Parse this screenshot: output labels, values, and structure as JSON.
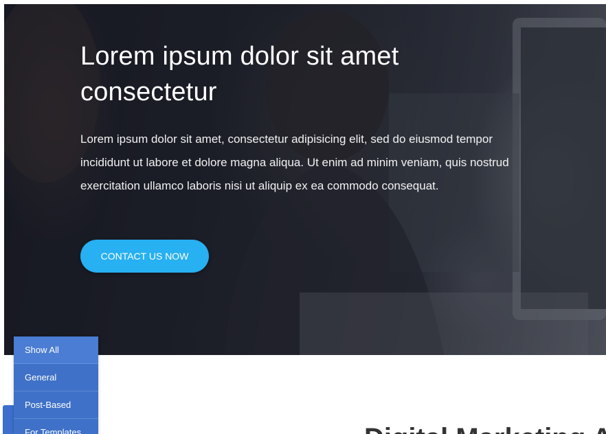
{
  "hero": {
    "title": "Lorem ipsum dolor sit amet consectetur",
    "text": "Lorem ipsum dolor sit amet, consectetur adipisicing elit, sed do eiusmod tempor incididunt ut labore et dolore magna aliqua. Ut enim ad minim veniam, quis nostrud exercitation ullamco laboris nisi ut aliquip ex ea commodo consequat.",
    "cta_label": "CONTACT US NOW"
  },
  "section": {
    "heading": "Digital Marketing A"
  },
  "filter_menu": {
    "items": [
      {
        "label": "Show All"
      },
      {
        "label": "General"
      },
      {
        "label": "Post-Based"
      },
      {
        "label": "For Templates"
      }
    ]
  },
  "colors": {
    "accent": "#27b0f2",
    "menu_bg": "#3f71c8"
  }
}
